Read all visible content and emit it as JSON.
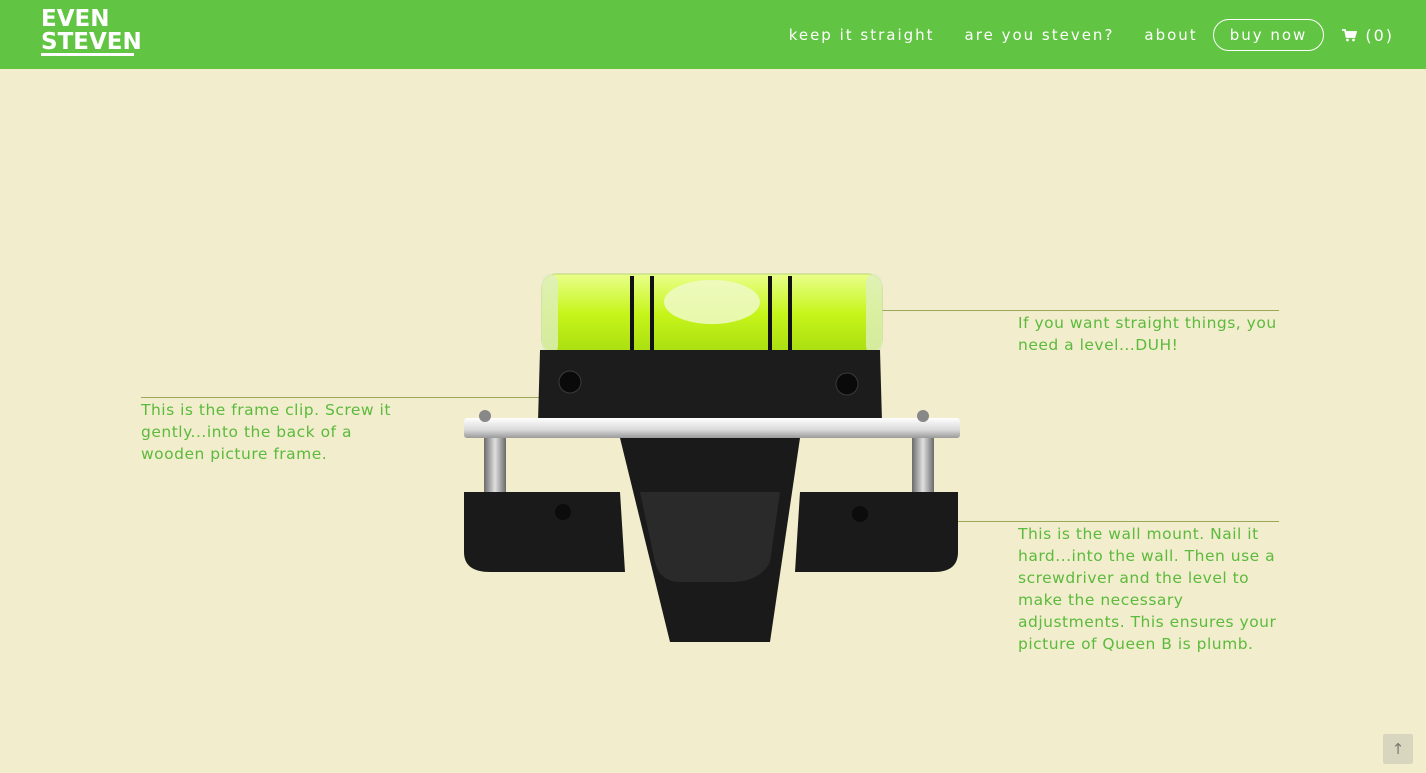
{
  "brand": {
    "line1": "EVEN",
    "line2": "STEVEN"
  },
  "nav": {
    "links": [
      "keep it straight",
      "are you steven?",
      "about"
    ],
    "buy_label": "buy now",
    "cart_count": "(0)",
    "cart_icon": "cart-icon"
  },
  "annotations": {
    "level": "If you want straight things, you need a level...DUH!",
    "frame_clip": "This is the frame clip. Screw it gently...into the back of a wooden picture frame.",
    "wall_mount": "This is the wall mount. Nail it hard...into the wall. Then use a screwdriver and the level to make the necessary adjustments. This ensures your picture of Queen B is plumb."
  },
  "colors": {
    "header_green": "#62c443",
    "background": "#f1edcd",
    "text_green": "#5cba3c"
  },
  "back_to_top_icon": "arrow-up-icon"
}
